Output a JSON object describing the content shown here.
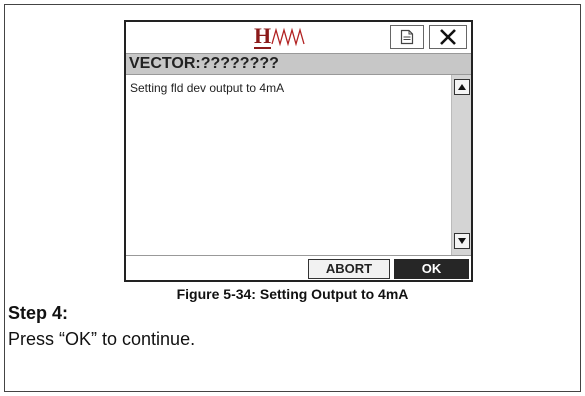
{
  "device": {
    "logo_text": "H",
    "header_title": "VECTOR:????????",
    "message": "Setting fld dev output to 4mA",
    "icons": {
      "logo_wave": "waveform-icon",
      "document": "document-icon",
      "close": "close-icon",
      "scroll_up": "scroll-up-icon",
      "scroll_down": "scroll-down-icon"
    },
    "buttons": {
      "abort": "ABORT",
      "ok": "OK"
    },
    "colors": {
      "logo": "#8b1a1a",
      "header_bg": "#c7c7c7",
      "ok_bg": "#262626"
    }
  },
  "caption": "Figure 5-34:  Setting Output to 4mA",
  "step": {
    "title": "Step 4:",
    "text": "Press “OK” to continue."
  }
}
